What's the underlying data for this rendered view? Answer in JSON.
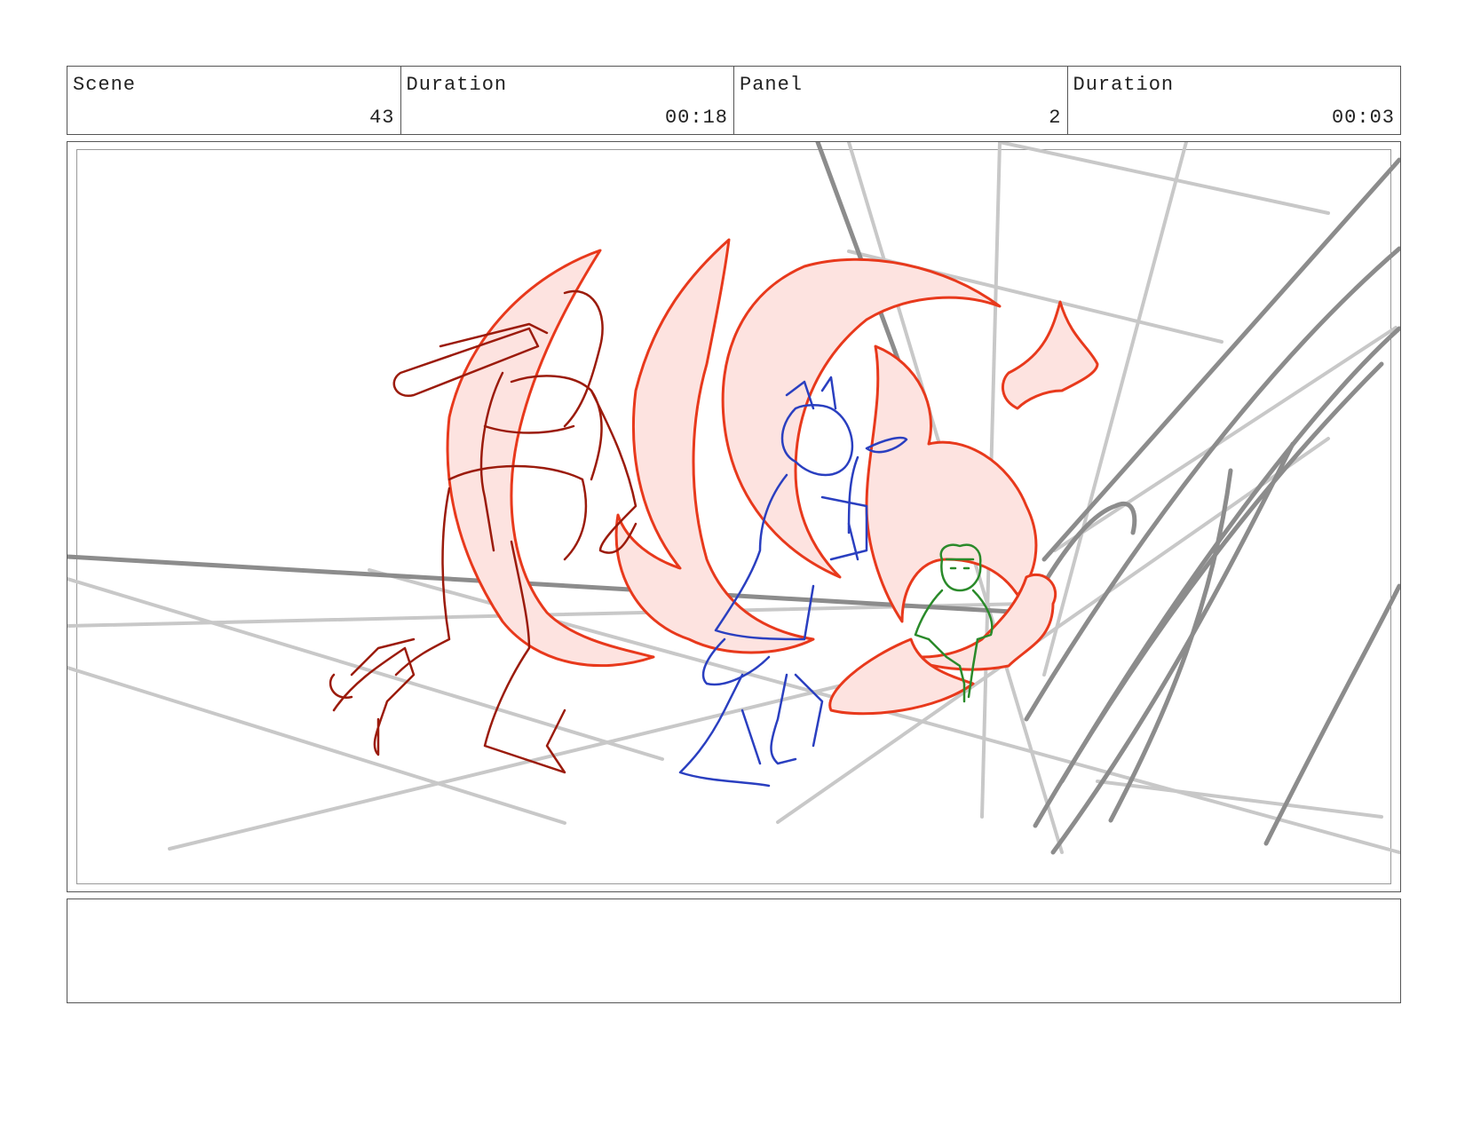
{
  "header": {
    "scene_label": "Scene",
    "scene_value": "43",
    "scene_duration_label": "Duration",
    "scene_duration_value": "00:18",
    "panel_label": "Panel",
    "panel_value": "2",
    "panel_duration_label": "Duration",
    "panel_duration_value": "00:03"
  },
  "notes": {
    "text": ""
  },
  "colors": {
    "border": "#555555",
    "grid_light": "#c8c8c8",
    "grid_dark": "#8c8c8c",
    "flame_stroke": "#e8391c",
    "flame_fill": "#fde3e0",
    "character_left": "#9b1b0c",
    "character_center": "#2a3fc0",
    "character_right": "#2a8a2a"
  }
}
